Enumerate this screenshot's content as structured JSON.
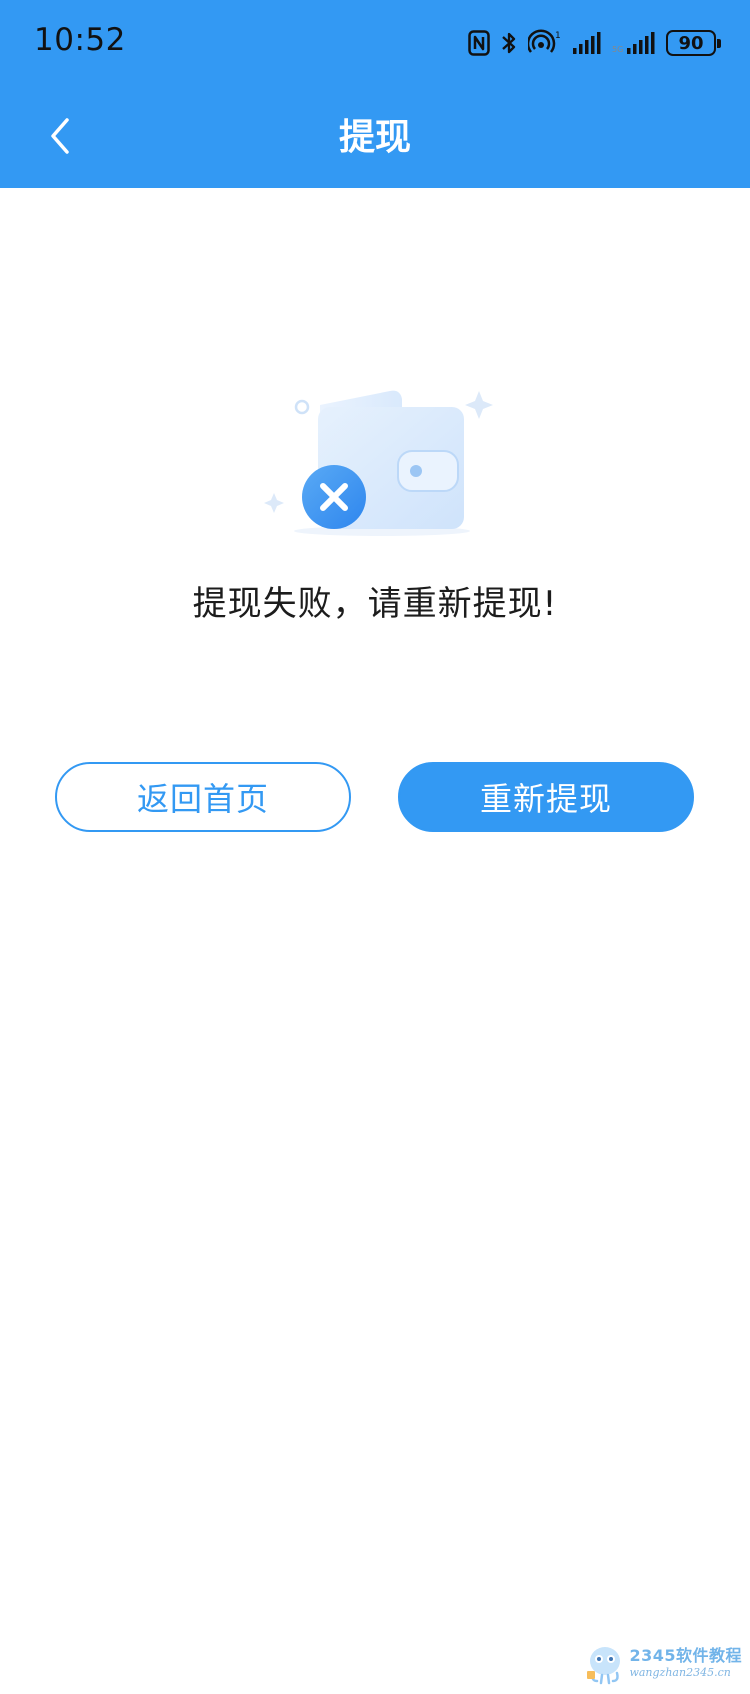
{
  "status_bar": {
    "time": "10:52",
    "battery": "90",
    "icons": [
      "nfc-icon",
      "bluetooth-icon",
      "hotspot-icon",
      "signal-icon",
      "signal-5g-icon",
      "battery-icon"
    ]
  },
  "nav": {
    "title": "提现",
    "back_icon": "chevron-left-icon"
  },
  "result": {
    "illustration": "wallet-failed-icon",
    "message": "提现失败，请重新提现!"
  },
  "actions": {
    "home_label": "返回首页",
    "retry_label": "重新提现"
  },
  "watermark": {
    "title": "2345软件教程",
    "url": "wangzhan2345.cn"
  },
  "colors": {
    "primary": "#3399f3",
    "text": "#1c1c1c",
    "background": "#ffffff"
  }
}
